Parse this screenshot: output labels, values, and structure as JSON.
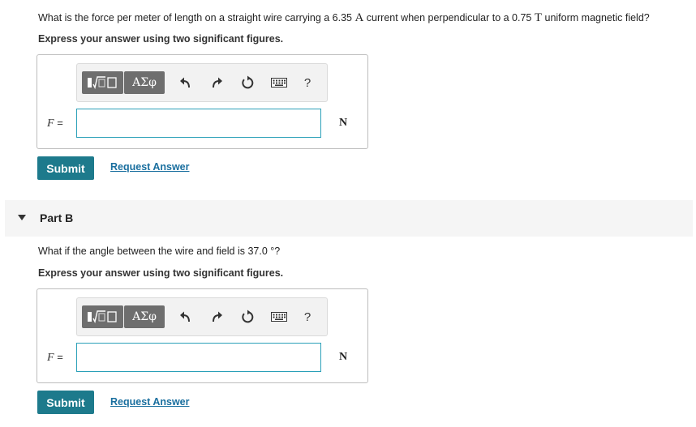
{
  "part_a": {
    "question_pre": "What is the force per meter of length on a straight wire carrying a 6.35 ",
    "current_unit": "A",
    "question_mid": " current when perpendicular to a 0.75 ",
    "field_unit": "T",
    "question_post": " uniform magnetic field?",
    "instruction": "Express your answer using two significant figures.",
    "variable": "F",
    "equals": "=",
    "answer_value": "",
    "unit": "N",
    "submit_label": "Submit",
    "request_label": "Request Answer"
  },
  "part_b": {
    "title": "Part B",
    "question": "What if the angle between the wire and field is 37.0 °?",
    "instruction": "Express your answer using two significant figures.",
    "variable": "F",
    "equals": "=",
    "answer_value": "",
    "unit": "N",
    "submit_label": "Submit",
    "request_label": "Request Answer"
  },
  "toolbar": {
    "symbols_label": "ΑΣφ",
    "help_label": "?",
    "icons": [
      "templates-icon",
      "undo-icon",
      "redo-icon",
      "reset-icon",
      "keyboard-icon",
      "help-icon"
    ]
  },
  "colors": {
    "submit_bg": "#1d7a8c",
    "link": "#1a6f9f",
    "input_border": "#2aa0b8",
    "toolbar_button": "#6e6e6e"
  }
}
